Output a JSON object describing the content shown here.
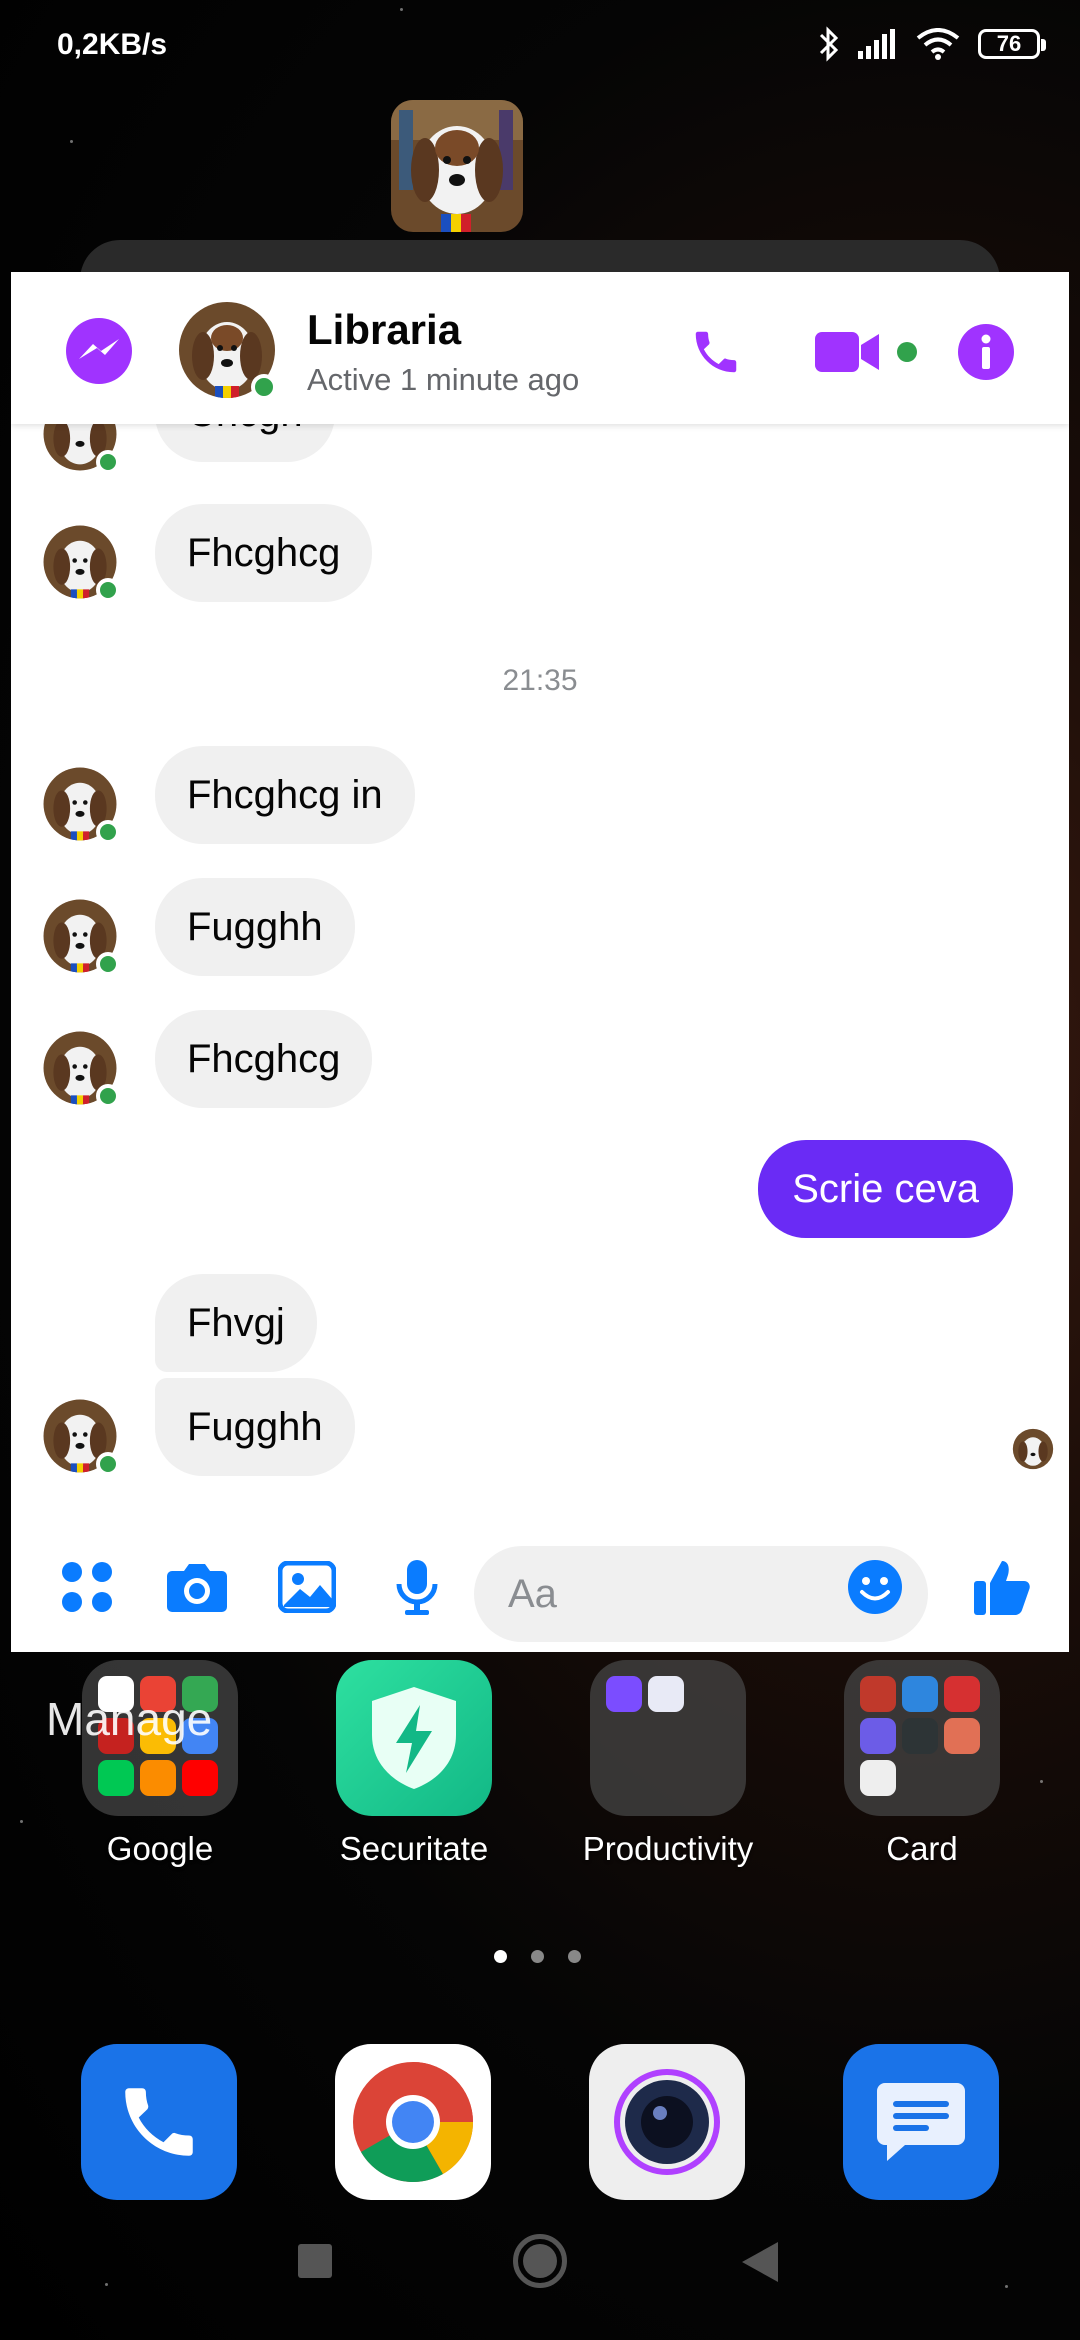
{
  "status_bar": {
    "speed": "0,2KB/s",
    "battery": "76"
  },
  "header": {
    "contact_name": "Libraria",
    "contact_status": "Active 1 minute ago"
  },
  "messages": {
    "partial_top": "Chcgh",
    "timestamp": "21:35",
    "items": [
      {
        "text": "Fhcghcg",
        "side": "in"
      },
      {
        "text": "Fhcghcg in",
        "side": "in"
      },
      {
        "text": "Fugghh",
        "side": "in"
      },
      {
        "text": "Fhcghcg",
        "side": "in"
      },
      {
        "text": "Scrie ceva",
        "side": "out"
      },
      {
        "text": "Fhvgj",
        "side": "in"
      },
      {
        "text": "Fugghh",
        "side": "in"
      }
    ]
  },
  "composer": {
    "placeholder": "Aa"
  },
  "home": {
    "manage_label": "Manage",
    "apps": [
      {
        "label": "Google"
      },
      {
        "label": "Securitate"
      },
      {
        "label": "Productivity"
      },
      {
        "label": "Card"
      }
    ]
  },
  "colors": {
    "messenger_purple": "#a033ff",
    "outgoing_bubble": "#6a2bf5",
    "composer_blue": "#0a7cff",
    "online_green": "#31a24c"
  }
}
